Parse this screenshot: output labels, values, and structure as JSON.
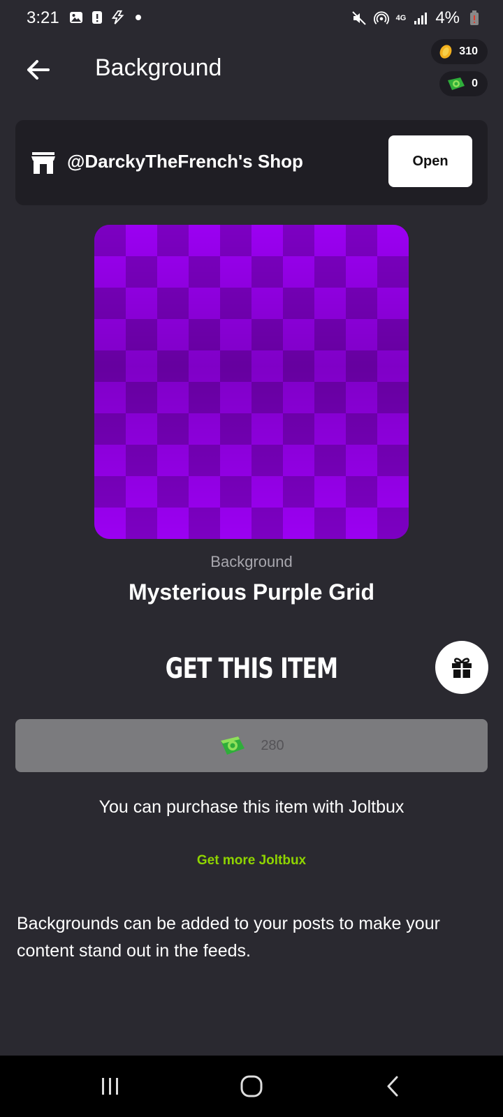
{
  "status_bar": {
    "time": "3:21",
    "network": "4G",
    "battery": "4%"
  },
  "header": {
    "title": "Background"
  },
  "wallet": {
    "coins": "310",
    "joltbux": "0"
  },
  "shop": {
    "name": "@DarckyTheFrench's Shop",
    "open_label": "Open"
  },
  "item": {
    "category": "Background",
    "name": "Mysterious Purple Grid",
    "preview_colors": [
      "#9b00f2",
      "#7c00c2"
    ]
  },
  "purchase": {
    "title": "GET THIS ITEM",
    "price": "280",
    "note": "You can purchase this item with Joltbux",
    "get_more_label": "Get more Joltbux"
  },
  "description": "Backgrounds can be added to your posts to make your content stand out in the feeds.",
  "icons": {
    "back": "arrow-left-icon",
    "shop": "storefront-icon",
    "gift": "gift-icon",
    "coin": "coin-icon",
    "joltbux": "joltbux-icon"
  },
  "colors": {
    "background": "#2a2930",
    "card": "#1f1e24",
    "accent_green": "#8fd400",
    "disabled_button": "#7b7b7e"
  }
}
